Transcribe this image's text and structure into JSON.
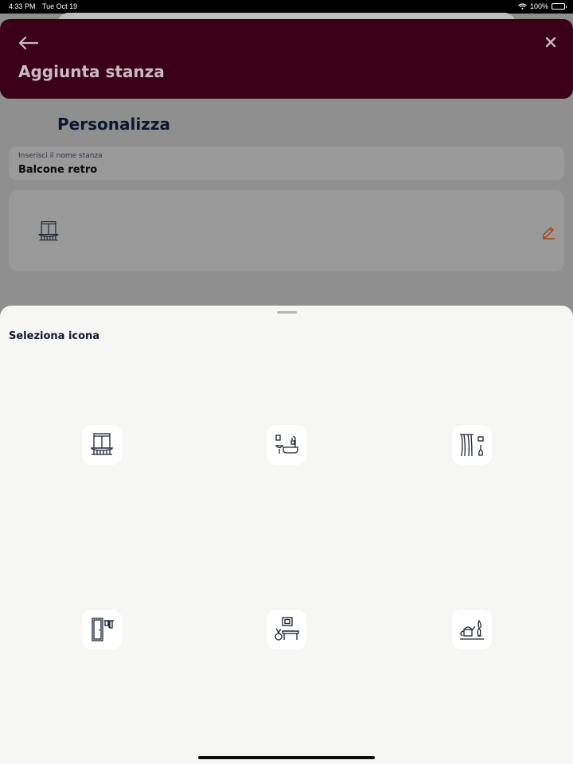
{
  "status_bar": {
    "time": "4:33 PM",
    "date": "Tue Oct 19",
    "battery": "100%"
  },
  "header": {
    "title": "Aggiunta stanza",
    "back_icon": "arrow-left-icon",
    "close_icon": "close-icon"
  },
  "main": {
    "section_title": "Personalizza",
    "name_field": {
      "label": "Inserisci il nome stanza",
      "value": "Balcone retro"
    },
    "selected_icon": "balcony-icon",
    "edit_icon": "pencil-icon"
  },
  "sheet": {
    "title": "Seleziona icona",
    "icons": [
      "balcony-icon",
      "bathroom-icon",
      "curtain-room-icon",
      "entrance-door-icon",
      "living-room-icon",
      "garden-shelf-icon"
    ]
  },
  "colors": {
    "header_bg": "#3a0017",
    "accent_edit": "#a8461d",
    "sheet_bg": "#f6f6f4"
  }
}
